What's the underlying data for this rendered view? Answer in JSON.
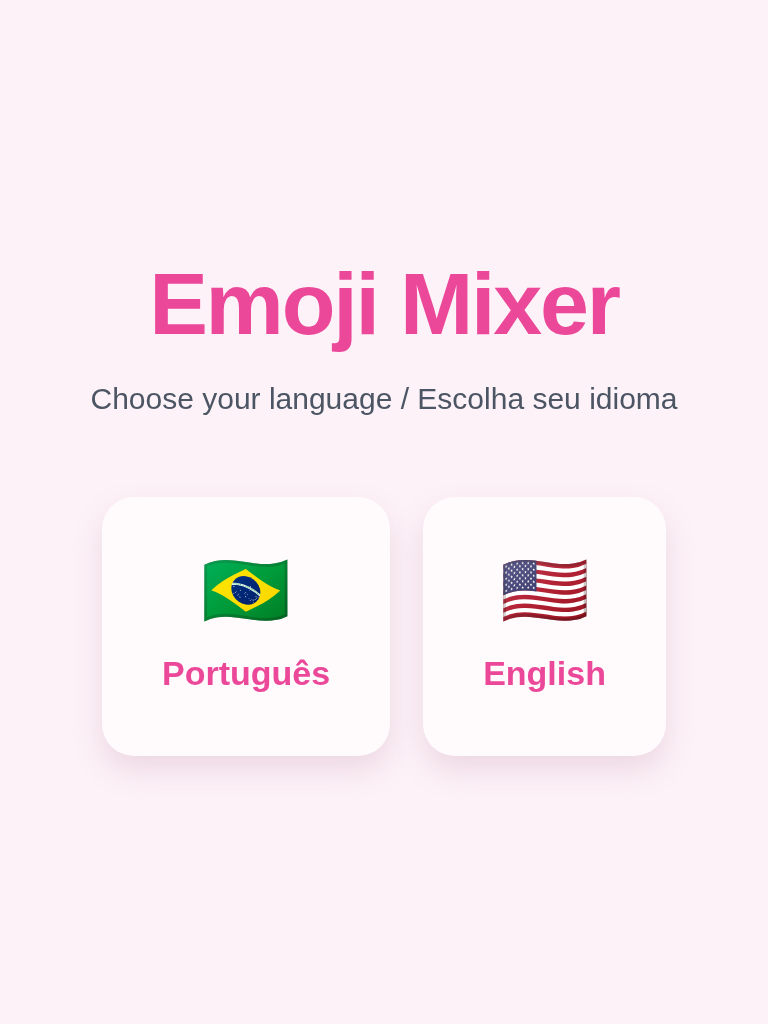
{
  "title": "Emoji Mixer",
  "subtitle": "Choose your language / Escolha seu idioma",
  "languages": [
    {
      "flag": "🇧🇷",
      "label": "Português"
    },
    {
      "flag": "🇺🇸",
      "label": "English"
    }
  ]
}
